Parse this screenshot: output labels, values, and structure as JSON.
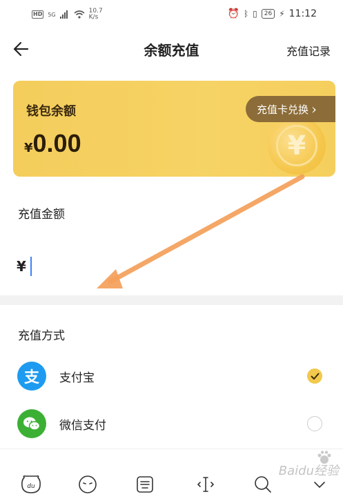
{
  "status_bar": {
    "hd": "HD",
    "signal": "5G",
    "speed_value": "10.7",
    "speed_unit": "K/s",
    "battery": "26",
    "time": "11:12"
  },
  "header": {
    "back_icon": "arrow-left-icon",
    "title": "余额充值",
    "records_label": "充值记录"
  },
  "wallet": {
    "label": "钱包余额",
    "currency": "¥",
    "balance": "0.00",
    "exchange_label": "充值卡兑换",
    "exchange_chevron": "›",
    "coin_symbol": "¥",
    "accent": "#f5cf5e"
  },
  "amount": {
    "section_label": "充值金额",
    "currency": "¥",
    "value": ""
  },
  "payment": {
    "section_label": "充值方式",
    "methods": [
      {
        "label": "支付宝",
        "icon": "alipay-icon",
        "icon_glyph": "支",
        "color": "#1d9bf0",
        "selected": true
      },
      {
        "label": "微信支付",
        "icon": "wechat-pay-icon",
        "color": "#3cb034",
        "selected": false
      }
    ]
  },
  "toolbar": {
    "items": [
      "du-keyboard-icon",
      "emoji-icon",
      "keyboard-icon",
      "cursor-move-icon",
      "search-icon"
    ],
    "watermark": "Baidu经验"
  },
  "colors": {
    "annotation_arrow": "#f4a05a",
    "selected_radio": "#f2c94c",
    "cursor": "#3b82f6"
  }
}
